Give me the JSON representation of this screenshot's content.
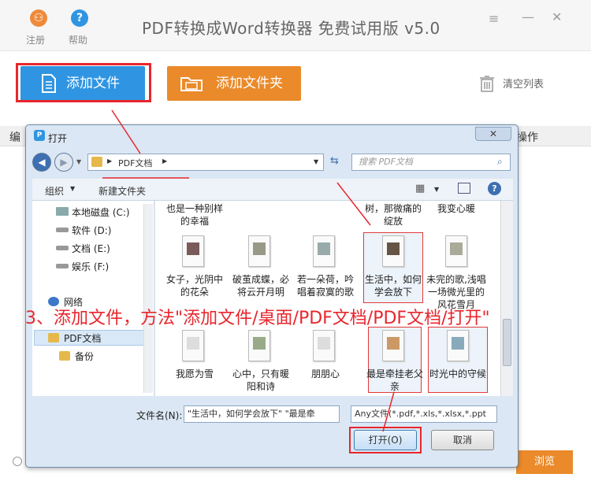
{
  "app": {
    "title": "PDF转换成Word转换器 免费试用版 v5.0",
    "register_label": "注册",
    "help_label": "帮助",
    "add_file_label": "添加文件",
    "add_folder_label": "添加文件夹",
    "clear_list_label": "清空列表",
    "col_index": "编",
    "col_actions": "操作",
    "browse_label": "浏览"
  },
  "dialog": {
    "title": "打开",
    "close": "✕",
    "address": "PDF文档",
    "search_placeholder": "搜索 PDF文档",
    "organize": "组织",
    "new_folder": "新建文件夹",
    "nav": [
      "本地磁盘 (C:)",
      "软件 (D:)",
      "文档 (E:)",
      "娱乐 (F:)",
      "网络",
      "PDF文档",
      "备份"
    ],
    "files_row0": [
      "也是一种别样的幸福",
      "树，那微痛的绽放",
      "我变心暖"
    ],
    "files_row1": [
      "女子，光阴中的花朵",
      "破茧成蝶，必将云开月明",
      "若一朵荷，吟唱着寂寞的歌",
      "生活中，如何学会放下",
      "未完的歌,浅唱一场微光里的风花雪月"
    ],
    "files_row2": [
      "我愿为雪",
      "心中，只有暖阳和诗",
      "朋朋心",
      "最是牵挂老父亲",
      "时光中的守候"
    ],
    "filename_label": "文件名(N):",
    "filename_value": "\"生活中，如何学会放下\" \"最是牵",
    "filter_value": "Any文件(*.pdf,*.xls,*.xlsx,*.ppt",
    "open_label": "打开(O)",
    "cancel_label": "取消"
  },
  "annotation": "3、添加文件，方法\"添加文件/桌面/PDF文档/PDF文档/打开\"",
  "colors": {
    "accent_blue": "#2f95e2",
    "accent_orange": "#ea8a2a",
    "annotation_red": "#e8262d"
  }
}
